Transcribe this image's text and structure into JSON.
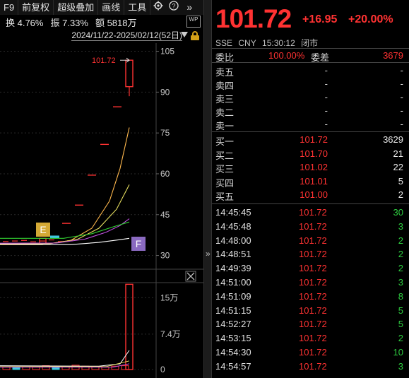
{
  "toolbar": {
    "items": [
      "F9",
      "前复权",
      "超级叠加",
      "画线",
      "工具"
    ],
    "expand_label": "»"
  },
  "stats": {
    "turnover": "换 4.76%",
    "amplitude": "振 7.33%",
    "amount": "额 5818万"
  },
  "date_range": "2024/11/22-2025/02/12(52日)",
  "wp_label": "WP",
  "chart": {
    "price_axis_ticks": [
      "105",
      "90",
      "75",
      "60",
      "45",
      "30"
    ],
    "price_tick_values": [
      105,
      90,
      75,
      60,
      45,
      30
    ],
    "price_range": [
      26,
      108
    ],
    "high_label": "101.72",
    "marker_e": "E",
    "marker_f": "F",
    "volume_axis_ticks": [
      "15万",
      "7.4万",
      "0"
    ],
    "volume_range": [
      0,
      18
    ]
  },
  "chart_data": {
    "type": "candlestick",
    "last_price": 101.72,
    "limit_up_candles": [
      {
        "index": 1,
        "close": 41.8
      },
      {
        "index": 2,
        "close": 48.5
      },
      {
        "index": 3,
        "close": 59.5
      },
      {
        "index": 4,
        "close": 70.8
      },
      {
        "index": 5,
        "close": 84.6
      }
    ],
    "last_candle": {
      "open": 92.0,
      "high": 101.72,
      "low": 88.5,
      "close": 101.72
    },
    "moving_average_colors": [
      "#ffb84d",
      "#e8e060",
      "#c050e0",
      "#30d030",
      "#ffffff"
    ],
    "last_volume_wan": 17.8
  },
  "quote": {
    "price": "101.72",
    "change": "+16.95",
    "change_pct": "+20.00%",
    "exchange": "SSE",
    "currency": "CNY",
    "time": "15:30:12",
    "status": "闭市"
  },
  "ratio": {
    "label": "委比",
    "value": "100.00%",
    "diff_label": "委差",
    "diff_value": "3679"
  },
  "asks": [
    {
      "label": "卖五",
      "price": "-",
      "qty": "-"
    },
    {
      "label": "卖四",
      "price": "-",
      "qty": "-"
    },
    {
      "label": "卖三",
      "price": "-",
      "qty": "-"
    },
    {
      "label": "卖二",
      "price": "-",
      "qty": "-"
    },
    {
      "label": "卖一",
      "price": "-",
      "qty": "-"
    }
  ],
  "bids": [
    {
      "label": "买一",
      "price": "101.72",
      "qty": "3629"
    },
    {
      "label": "买二",
      "price": "101.70",
      "qty": "21"
    },
    {
      "label": "买三",
      "price": "101.02",
      "qty": "22"
    },
    {
      "label": "买四",
      "price": "101.01",
      "qty": "5"
    },
    {
      "label": "买五",
      "price": "101.00",
      "qty": "2"
    }
  ],
  "trades": [
    {
      "time": "14:45:45",
      "price": "101.72",
      "qty": "30"
    },
    {
      "time": "14:45:48",
      "price": "101.72",
      "qty": "3"
    },
    {
      "time": "14:48:00",
      "price": "101.72",
      "qty": "2"
    },
    {
      "time": "14:48:51",
      "price": "101.72",
      "qty": "2"
    },
    {
      "time": "14:49:39",
      "price": "101.72",
      "qty": "2"
    },
    {
      "time": "14:51:00",
      "price": "101.72",
      "qty": "3"
    },
    {
      "time": "14:51:09",
      "price": "101.72",
      "qty": "8"
    },
    {
      "time": "14:51:15",
      "price": "101.72",
      "qty": "5"
    },
    {
      "time": "14:52:27",
      "price": "101.72",
      "qty": "5"
    },
    {
      "time": "14:53:15",
      "price": "101.72",
      "qty": "2"
    },
    {
      "time": "14:54:30",
      "price": "101.72",
      "qty": "10"
    },
    {
      "time": "14:54:57",
      "price": "101.72",
      "qty": "3"
    }
  ],
  "colors": {
    "up": "#ff3232",
    "down": "#2ecc40",
    "accent": "#d4a017"
  }
}
